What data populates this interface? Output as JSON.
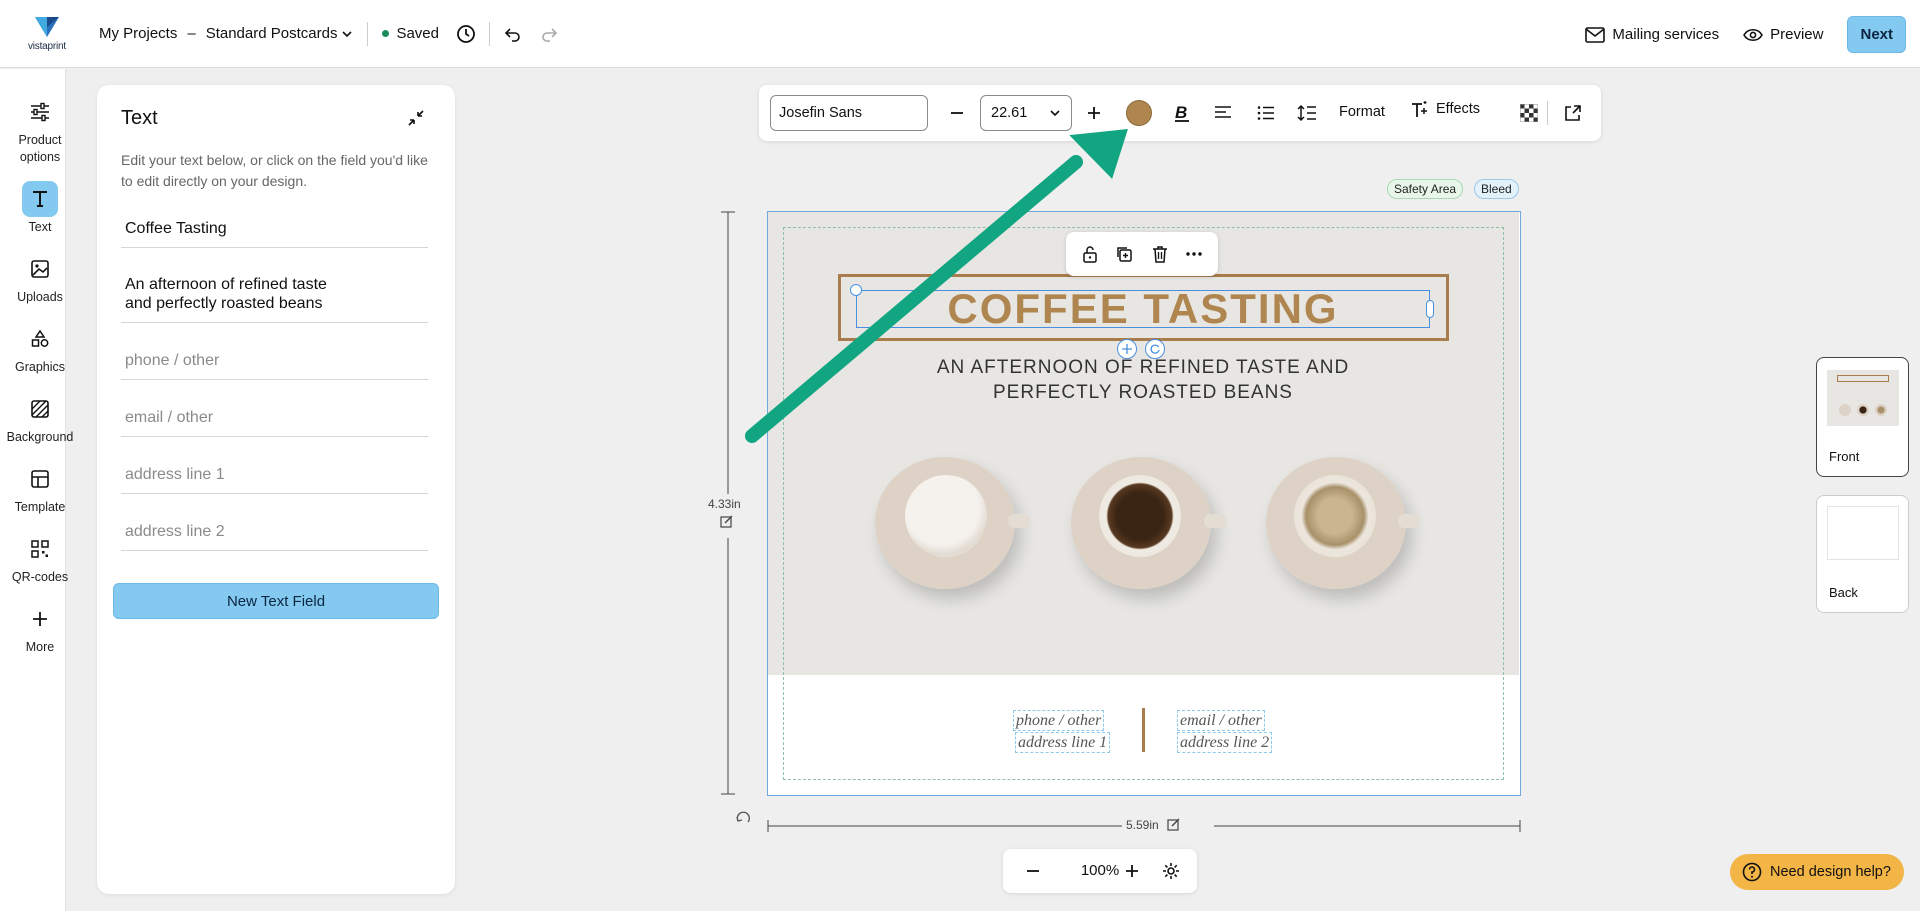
{
  "topbar": {
    "logo_text": "vistaprint",
    "my_projects": "My Projects",
    "separator": "–",
    "project_name": "Standard Postcards",
    "saved_label": "Saved",
    "mailing_label": "Mailing services",
    "preview_label": "Preview",
    "next_label": "Next"
  },
  "rail": {
    "items": [
      {
        "label": "Product options",
        "icon": "sliders-icon"
      },
      {
        "label": "Text",
        "icon": "text-icon"
      },
      {
        "label": "Uploads",
        "icon": "image-icon"
      },
      {
        "label": "Graphics",
        "icon": "shapes-icon"
      },
      {
        "label": "Background",
        "icon": "hatch-icon"
      },
      {
        "label": "Template",
        "icon": "template-icon"
      },
      {
        "label": "QR-codes",
        "icon": "qr-icon"
      },
      {
        "label": "More",
        "icon": "plus-icon"
      }
    ]
  },
  "panel": {
    "title": "Text",
    "description": "Edit your text below, or click on the field you'd like to edit directly on your design.",
    "fields": [
      {
        "value": "Coffee Tasting"
      },
      {
        "value_line1": "An afternoon of refined taste",
        "value_line2": "and perfectly roasted beans"
      },
      {
        "placeholder": "phone / other"
      },
      {
        "placeholder": "email / other"
      },
      {
        "placeholder": "address line 1"
      },
      {
        "placeholder": "address line 2"
      }
    ],
    "new_field_label": "New Text Field"
  },
  "toolbar": {
    "font": "Josefin Sans",
    "size": "22.61",
    "text_color": "#b08650",
    "format_label": "Format",
    "effects_label": "Effects"
  },
  "canvas": {
    "safety_area_label": "Safety Area",
    "bleed_label": "Bleed",
    "title": "COFFEE TASTING",
    "subtitle_line1": "AN AFTERNOON OF REFINED TASTE AND",
    "subtitle_line2": "PERFECTLY ROASTED BEANS",
    "phone": "phone / other",
    "address1": "address line 1",
    "email": "email / other",
    "address2": "address line 2",
    "height_label": "4.33in",
    "width_label": "5.59in",
    "accent_color": "#a87c4c"
  },
  "zoom": {
    "value": "100%"
  },
  "pages": {
    "front_label": "Front",
    "back_label": "Back"
  },
  "help": {
    "label": "Need design help?"
  }
}
